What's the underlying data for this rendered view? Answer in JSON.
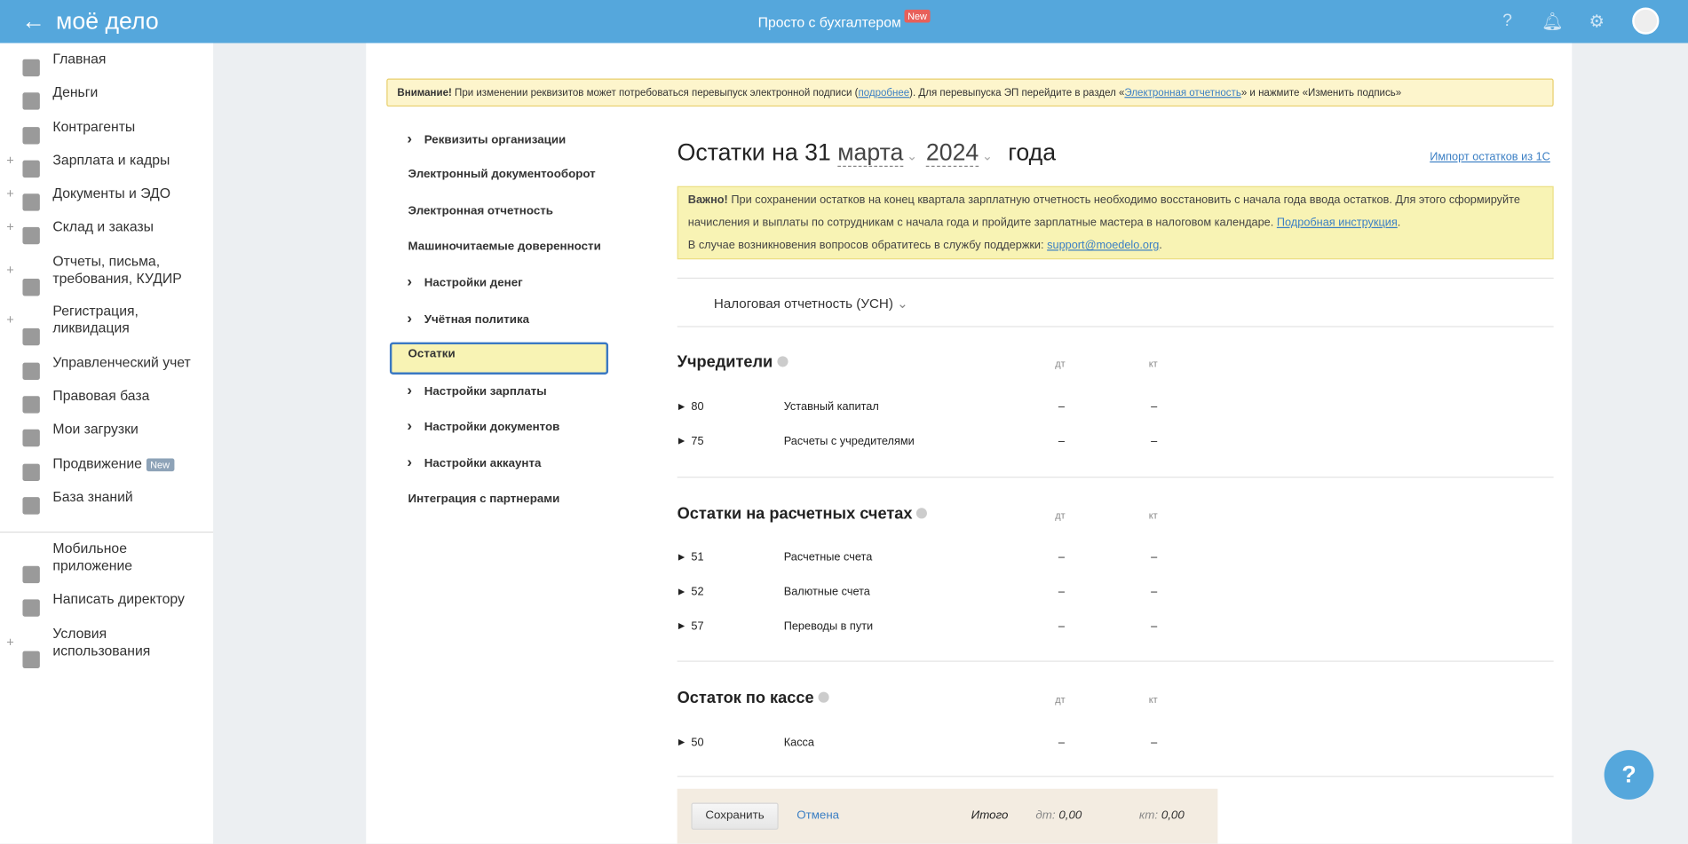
{
  "header": {
    "logo": "моё дело",
    "title": "Просто с бухгалтером",
    "new_badge": "New"
  },
  "sidebar": {
    "items": [
      {
        "label": "Главная"
      },
      {
        "label": "Деньги"
      },
      {
        "label": "Контрагенты"
      },
      {
        "label": "Зарплата и кадры"
      },
      {
        "label": "Документы и ЭДО"
      },
      {
        "label": "Склад и заказы"
      },
      {
        "label": "Отчеты, письма, требования, КУДИР"
      },
      {
        "label": "Регистрация, ликвидация"
      },
      {
        "label": "Управленческий учет"
      },
      {
        "label": "Правовая база"
      },
      {
        "label": "Мои загрузки"
      },
      {
        "label": "Продвижение",
        "badge": "New"
      },
      {
        "label": "База знаний"
      },
      {
        "label": "Мобильное приложение"
      },
      {
        "label": "Написать директору"
      },
      {
        "label": "Условия использования"
      }
    ]
  },
  "alert": {
    "bold": "Внимание!",
    "text1": " При изменении реквизитов может потребоваться перевыпуск электронной подписи (",
    "link1": "подробнее",
    "text2": "). Для перевыпуска ЭП перейдите в раздел «",
    "link2": "Электронная отчетность",
    "text3": "» и нажмите «Изменить подпись»"
  },
  "settings_menu": [
    "Реквизиты организации",
    "Электронный документооборот",
    "Электронная отчетность",
    "Машиночитаемые доверенности",
    "Настройки денег",
    "Учётная политика",
    "Остатки",
    "Настройки зарплаты",
    "Настройки документов",
    "Настройки аккаунта",
    "Интеграция с партнерами"
  ],
  "main": {
    "title_prefix": "Остатки на 31",
    "month": "марта",
    "year": "2024",
    "title_suffix": "года",
    "import_link": "Импорт остатков из 1С",
    "important": {
      "bold": "Важно!",
      "text1": " При сохранении остатков на конец квартала зарплатную отчетность необходимо восстановить с начала года ввода остатков. Для этого сформируйте начисления и выплаты по сотрудникам с начала года и пройдите зарплатные мастера в налоговом календаре. ",
      "link1": "Подробная инструкция",
      "text2": "В случае возникновения вопросов обратитесь в службу поддержки: ",
      "email": "support@moedelo.org"
    },
    "tab": "Налоговая отчетность (УСН)",
    "col_dt": "дт",
    "col_kt": "кт",
    "sections": [
      {
        "title": "Учредители",
        "rows": [
          {
            "code": "80",
            "name": "Уставный капитал",
            "dt": "–",
            "kt": "–"
          },
          {
            "code": "75",
            "name": "Расчеты с учредителями",
            "dt": "–",
            "kt": "–"
          }
        ]
      },
      {
        "title": "Остатки на расчетных счетах",
        "rows": [
          {
            "code": "51",
            "name": "Расчетные счета",
            "dt": "–",
            "kt": "–"
          },
          {
            "code": "52",
            "name": "Валютные счета",
            "dt": "–",
            "kt": "–"
          },
          {
            "code": "57",
            "name": "Переводы в пути",
            "dt": "–",
            "kt": "–"
          }
        ]
      },
      {
        "title": "Остаток по кассе",
        "rows": [
          {
            "code": "50",
            "name": "Касса",
            "dt": "–",
            "kt": "–"
          }
        ]
      }
    ]
  },
  "footer": {
    "save": "Сохранить",
    "cancel": "Отмена",
    "total": "Итого",
    "dt_label": "дт:",
    "dt_value": "0,00",
    "kt_label": "кт:",
    "kt_value": "0,00"
  }
}
